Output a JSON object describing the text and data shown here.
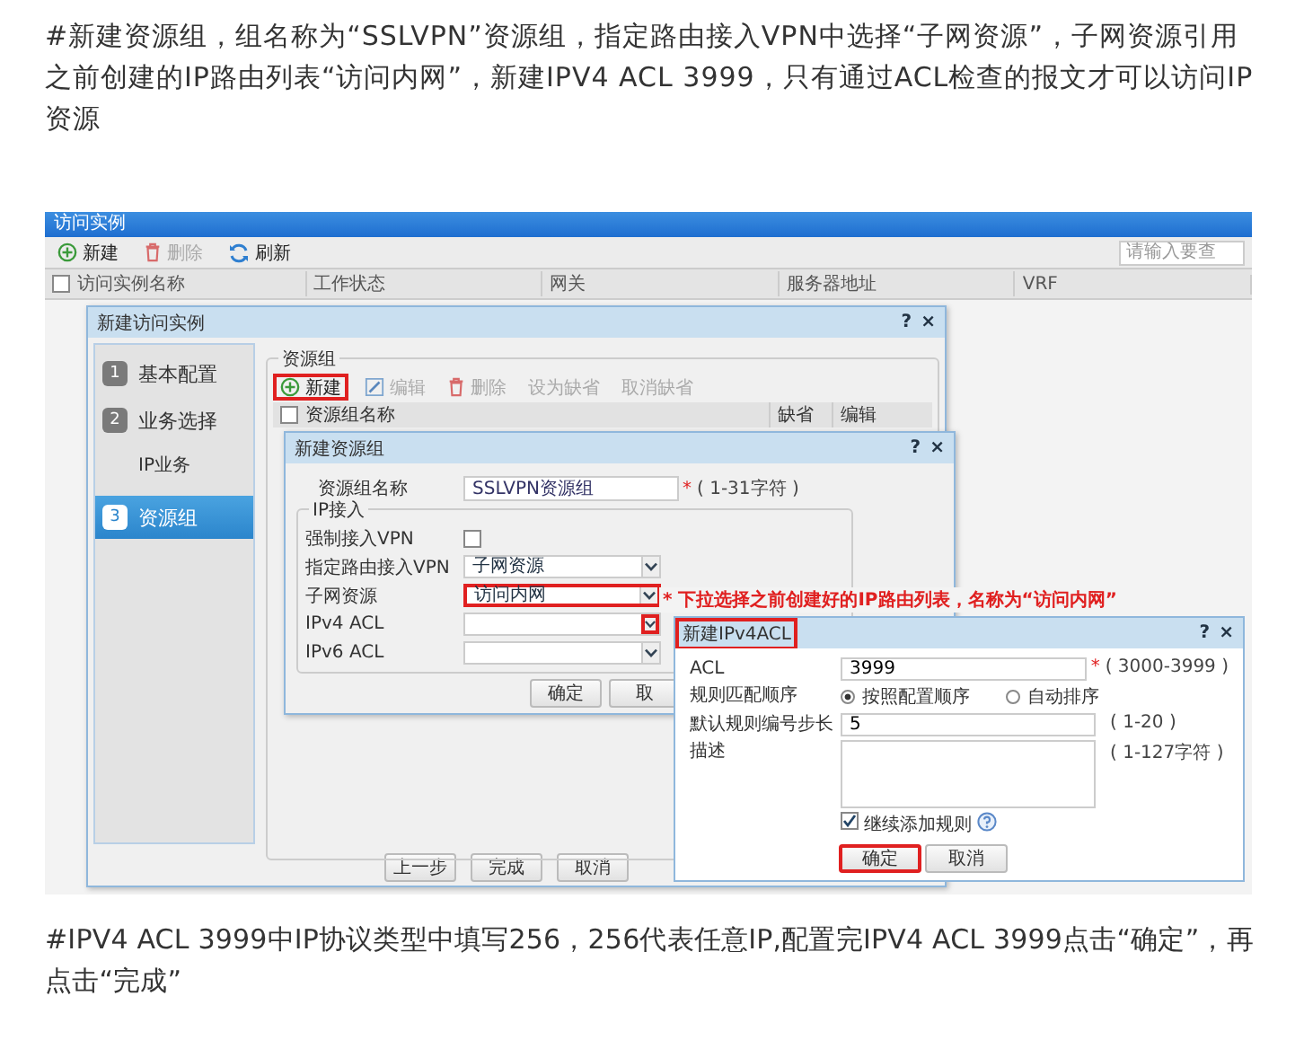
{
  "intro": "#新建资源组，组名称为“SSLVPN”资源组，指定路由接入VPN中选择“子网资源”，子网资源引用之前创建的IP路由列表“访问内网”，新建IPV4 ACL 3999，只有通过ACL检查的报文才可以访问IP资源",
  "screenshot": {
    "main_window": {
      "title": "访问实例",
      "toolbar": [
        {
          "kind": "add",
          "label": "新建",
          "disabled": false
        },
        {
          "kind": "delete",
          "label": "删除",
          "disabled": true
        },
        {
          "kind": "refresh",
          "label": "刷新",
          "disabled": false
        }
      ],
      "search": {
        "placeholder": "请输入要查"
      },
      "select_all_checked": false,
      "columns": [
        "访问实例名称",
        "工作状态",
        "网关",
        "服务器地址",
        "VRF"
      ]
    },
    "wizard": {
      "title": "新建访问实例",
      "controls": [
        "?",
        "×"
      ],
      "steps": [
        {
          "number": "1",
          "label": "基本配置",
          "selected": false
        },
        {
          "number": "2",
          "label": "业务选择",
          "selected": false,
          "children": [
            {
              "label": "IP业务",
              "selected": false
            }
          ]
        },
        {
          "number": "3",
          "label": "资源组",
          "selected": true
        }
      ],
      "legend": "资源组",
      "toolbar": [
        {
          "kind": "add",
          "label": "新建",
          "disabled": false,
          "highlighted": true
        },
        {
          "kind": "edit",
          "label": "编辑",
          "disabled": true,
          "highlighted": false
        },
        {
          "kind": "delete",
          "label": "删除",
          "disabled": true,
          "highlighted": false
        },
        {
          "kind": "text",
          "label": "设为缺省",
          "disabled": true,
          "highlighted": false
        },
        {
          "kind": "text",
          "label": "取消缺省",
          "disabled": true,
          "highlighted": false
        }
      ],
      "columns": [
        "资源组名称",
        "缺省",
        "编辑"
      ],
      "select_all_checked": false,
      "buttons": [
        "上一步",
        "完成",
        "取消"
      ]
    },
    "group_dialog": {
      "title": "新建资源组",
      "controls": [
        "?",
        "×"
      ],
      "name_label": "资源组名称",
      "name_value": "SSLVPN资源组",
      "required_mark": "*",
      "name_hint": "( 1-31字符 )",
      "fieldset": "IP接入",
      "rows": [
        {
          "kind": "checkbox",
          "label": "强制接入VPN",
          "checked": false
        },
        {
          "kind": "select",
          "label": "指定路由接入VPN",
          "value": "子网资源",
          "highlighted": false,
          "arrow_highlighted": false
        },
        {
          "kind": "select",
          "label": "子网资源",
          "value": "访问内网",
          "highlighted": true,
          "arrow_highlighted": false
        },
        {
          "kind": "select",
          "label": "IPv4 ACL",
          "highlighted": false,
          "arrow_highlighted": true
        },
        {
          "kind": "select",
          "label": "IPv6 ACL",
          "highlighted": false,
          "arrow_highlighted": false
        }
      ],
      "buttons": [
        "确定",
        "取"
      ]
    },
    "annotation": "* 下拉选择之前创建好的IP路由列表，名称为“访问内网”",
    "acl_dialog": {
      "title": "新建IPv4ACL",
      "title_highlighted": true,
      "controls": [
        "?",
        "×"
      ],
      "rows": [
        {
          "kind": "input",
          "label": "ACL",
          "value": "3999",
          "required_mark": "*",
          "hint": "( 3000-3999 )"
        },
        {
          "kind": "radio",
          "label": "规则匹配顺序",
          "options": [
            {
              "label": "按照配置顺序",
              "selected": true
            },
            {
              "label": "自动排序",
              "selected": false
            }
          ]
        },
        {
          "kind": "input",
          "label": "默认规则编号步长",
          "value": "5",
          "hint": "( 1-20 )"
        },
        {
          "kind": "textarea",
          "label": "描述",
          "hint": "( 1-127字符 )"
        }
      ],
      "continue": {
        "label": "继续添加规则",
        "checked": true
      },
      "buttons": [
        {
          "label": "确定",
          "highlighted": true
        },
        {
          "label": "取消",
          "highlighted": false
        }
      ]
    }
  },
  "outro": "#IPV4 ACL 3999中IP协议类型中填写256，256代表任意IP,配置完IPV4 ACL 3999点击“确定”，再点击“完成”"
}
